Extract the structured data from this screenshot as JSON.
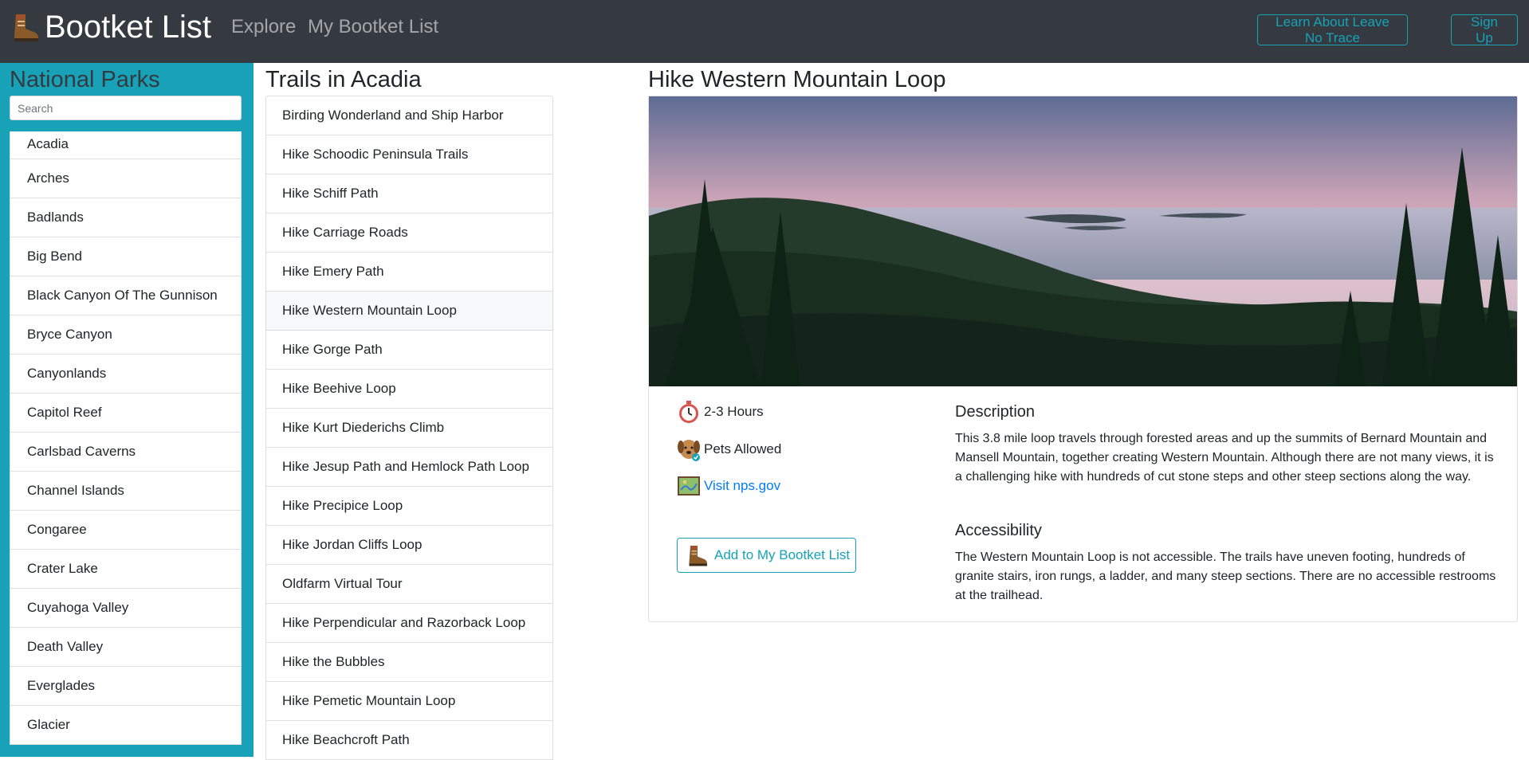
{
  "navbar": {
    "brand": "Bootket List",
    "links": {
      "explore": "Explore",
      "my_list": "My Bootket List"
    },
    "buttons": {
      "leave_no_trace": "Learn About Leave No Trace",
      "sign_up": "Sign Up"
    }
  },
  "sidebar": {
    "title": "National Parks",
    "search_placeholder": "Search",
    "parks": [
      "Acadia",
      "Arches",
      "Badlands",
      "Big Bend",
      "Black Canyon Of The Gunnison",
      "Bryce Canyon",
      "Canyonlands",
      "Capitol Reef",
      "Carlsbad Caverns",
      "Channel Islands",
      "Congaree",
      "Crater Lake",
      "Cuyahoga Valley",
      "Death Valley",
      "Everglades",
      "Glacier"
    ]
  },
  "trails": {
    "title": "Trails in Acadia",
    "items": [
      "Birding Wonderland and Ship Harbor",
      "Hike Schoodic Peninsula Trails",
      "Hike Schiff Path",
      "Hike Carriage Roads",
      "Hike Emery Path",
      "Hike Western Mountain Loop",
      "Hike Gorge Path",
      "Hike Beehive Loop",
      "Hike Kurt Diederichs Climb",
      "Hike Jesup Path and Hemlock Path Loop",
      "Hike Precipice Loop",
      "Hike Jordan Cliffs Loop",
      "Oldfarm Virtual Tour",
      "Hike Perpendicular and Razorback Loop",
      "Hike the Bubbles",
      "Hike Pemetic Mountain Loop",
      "Hike Beachcroft Path"
    ],
    "active_index": 5
  },
  "detail": {
    "title": "Hike Western Mountain Loop",
    "duration": "2-3 Hours",
    "pets": "Pets Allowed",
    "link_text": "Visit nps.gov",
    "add_button": "Add to My Bootket List",
    "description_heading": "Description",
    "description": "This 3.8 mile loop travels through forested areas and up the summits of Bernard Mountain and Mansell Mountain, together creating Western Mountain. Although there are not many views, it is a challenging hike with hundreds of cut stone steps and other steep sections along the way.",
    "accessibility_heading": "Accessibility",
    "accessibility": "The Western Mountain Loop is not accessible. The trails have uneven footing, hundreds of granite stairs, iron rungs, a ladder, and many steep sections. There are no accessible restrooms at the trailhead."
  },
  "colors": {
    "navbar_bg": "#343a40",
    "accent": "#17a2b8",
    "link": "#007bff"
  },
  "icons": {
    "brand": "hiking-boot-icon",
    "duration": "stopwatch-icon",
    "pets": "dog-icon",
    "link": "map-icon",
    "add": "hiking-boot-icon"
  }
}
